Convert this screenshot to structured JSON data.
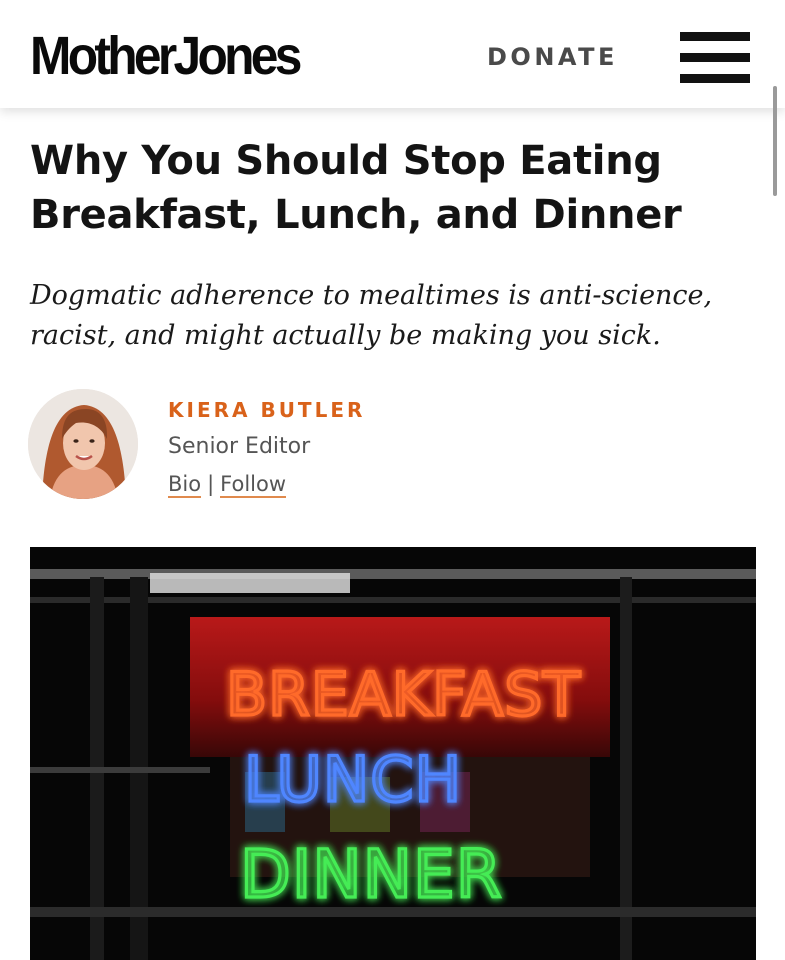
{
  "header": {
    "logo": "MotherJones",
    "donate_label": "DONATE",
    "menu_icon": "hamburger-menu-icon"
  },
  "article": {
    "headline": "Why You Should Stop Eating Breakfast, Lunch, and Dinner",
    "dek": "Dogmatic adherence to mealtimes is anti-science, racist, and might actually be making you sick."
  },
  "author": {
    "name": "KIERA BUTLER",
    "title": "Senior Editor",
    "bio_link": "Bio",
    "separator": "|",
    "follow_link": "Follow"
  },
  "hero_image": {
    "sign_words": [
      "BREAKFAST",
      "LUNCH",
      "DINNER"
    ]
  },
  "colors": {
    "accent": "#d9621a",
    "neon_red": "#ff3b2a",
    "neon_blue": "#3f7dff",
    "neon_green": "#36e24a"
  }
}
